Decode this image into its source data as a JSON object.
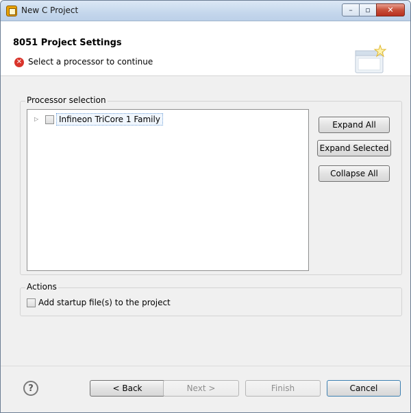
{
  "window": {
    "title": "New C Project",
    "buttons": {
      "minimize": "–",
      "maximize": "▫",
      "close": "✕"
    }
  },
  "header": {
    "title": "8051 Project Settings",
    "message": "Select a processor to continue",
    "icons": {
      "error": "error-icon",
      "wizard": "wizard-banner-icon"
    }
  },
  "processor_selection": {
    "label": "Processor selection",
    "tree_items": [
      {
        "label": "Infineon TriCore 1 Family",
        "expanded": false,
        "checked": false
      }
    ],
    "buttons": {
      "expand_all": "Expand All",
      "expand_selected": "Expand Selected",
      "collapse_all": "Collapse All"
    }
  },
  "actions": {
    "label": "Actions",
    "add_startup_files": {
      "label": "Add startup file(s) to the project",
      "checked": false
    }
  },
  "footer": {
    "help": "?",
    "back": "< Back",
    "next": "Next >",
    "finish": "Finish",
    "cancel": "Cancel"
  },
  "colors": {
    "error_red": "#d9342b",
    "focus_blue": "#3c7fb1",
    "close_button_red": "#c8503a"
  }
}
